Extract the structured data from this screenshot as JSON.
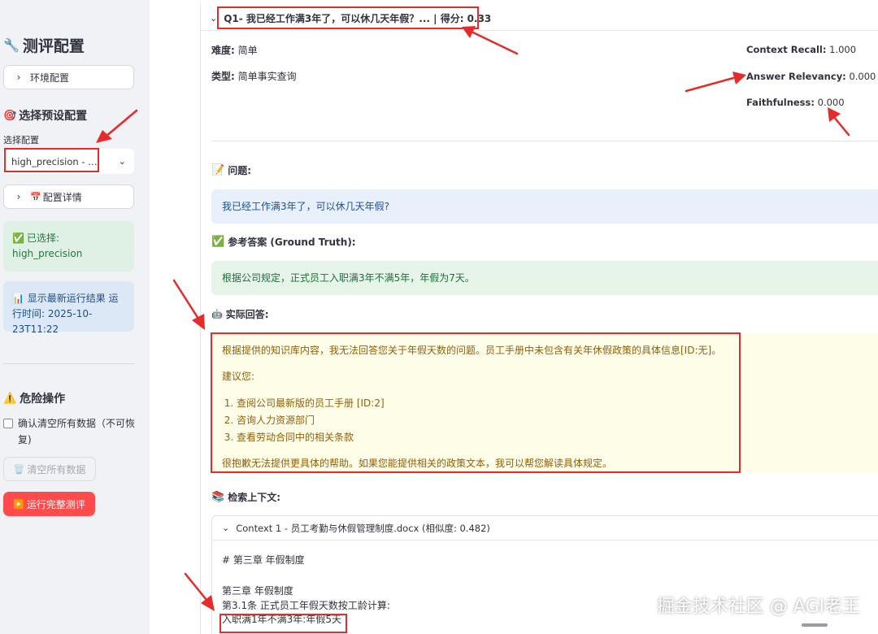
{
  "sidebar": {
    "title": "测评配置",
    "env_config_label": "环境配置",
    "preset_title": "选择预设配置",
    "select_label": "选择配置",
    "select_value": "high_precision - 高...",
    "config_detail_label": "配置详情",
    "selected_title": "已选择:",
    "selected_value": "high_precision",
    "run_info": "显示最新运行结果 运行时间: 2025-10-23T11:22",
    "danger_title": "危险操作",
    "confirm_clear_label": "确认清空所有数据（不可恢复)",
    "clear_button": "清空所有数据",
    "run_button": "运行完整测评"
  },
  "question": {
    "header": "Q1- 我已经工作满3年了，可以休几天年假？... | 得分: 0.33",
    "difficulty_key": "难度:",
    "difficulty_value": "简单",
    "type_key": "类型:",
    "type_value": "简单事实查询"
  },
  "metrics": [
    {
      "name": "Context Recall:",
      "value": "1.000"
    },
    {
      "name": "Answer Relevancy:",
      "value": "0.000"
    },
    {
      "name": "Faithfulness:",
      "value": "0.000"
    }
  ],
  "sections": {
    "question_title": "问题:",
    "question_text": "我已经工作满3年了，可以休几天年假?",
    "reference_title": "参考答案 (Ground Truth):",
    "reference_text": "根据公司规定，正式员工入职满3年不满5年，年假为7天。",
    "actual_title": "实际回答:",
    "actual_p1": "根据提供的知识库内容，我无法回答您关于年假天数的问题。员工手册中未包含有关年休假政策的具体信息[ID:无]。",
    "actual_p2": "建议您:",
    "actual_items": [
      "查阅公司最新版的员工手册 [ID:2]",
      "咨询人力资源部门",
      "查看劳动合同中的相关条款"
    ],
    "actual_p3": "很抱歉无法提供更具体的帮助。如果您能提供相关的政策文本，我可以帮您解读具体规定。",
    "context_title": "检索上下文:",
    "context_header": "Context 1 - 员工考勤与休假管理制度.docx (相似度: 0.482)",
    "context_line1": "# 第三章 年假制度",
    "context_line2": "第三章 年假制度",
    "context_line3": "第3.1条 正式员工年假天数按工龄计算:",
    "context_line4": "入职满1年不满3年:年假5天"
  },
  "watermark": "掘金技术社区 @ AGI老王",
  "icons": [
    "wrench-icon",
    "target-icon",
    "chevron-right-icon",
    "chevron-down-icon",
    "calendar-icon",
    "check-icon",
    "chart-icon",
    "warning-icon",
    "trash-icon",
    "play-icon",
    "memo-icon",
    "robot-icon",
    "books-icon"
  ],
  "colors": {
    "primary": "#ff4b4b",
    "annotation_red": "#e62b2b",
    "success_bg": "#dff1e4",
    "info_bg": "#dde8f6",
    "warn_bg": "#fdfde8"
  }
}
